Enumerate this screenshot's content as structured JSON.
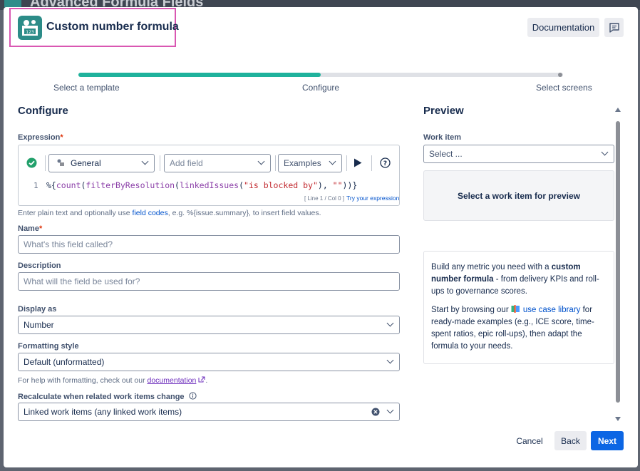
{
  "background": {
    "title": "Advanced Formula Fields"
  },
  "header": {
    "title": "Custom number formula",
    "documentation_label": "Documentation",
    "logo_badge": "123"
  },
  "stepper": {
    "steps": [
      {
        "label": "Select a template"
      },
      {
        "label": "Configure"
      },
      {
        "label": "Select screens"
      }
    ],
    "progress": 0.5
  },
  "configure": {
    "heading": "Configure",
    "expression": {
      "label": "Expression",
      "required_mark": "*",
      "context_select": "General",
      "add_field_placeholder": "Add field",
      "examples_label": "Examples",
      "line_number": "1",
      "code_prefix": "%{",
      "code_fn1": "count",
      "code_fn2": "filterByResolution",
      "code_fn3": "linkedIssues",
      "code_str1": "\"is blocked by\"",
      "code_sep": ", ",
      "code_str2": "\"\"",
      "code_suffix": "))}",
      "cursor_position": "[ Line 1 / Col 0 ]",
      "try_link": "Try your expression",
      "hint_prefix": "Enter plain text and optionally use ",
      "hint_link": "field codes",
      "hint_suffix": ", e.g. %{issue.summary}, to insert field values."
    },
    "name": {
      "label": "Name",
      "required_mark": "*",
      "placeholder": "What's this field called?"
    },
    "description": {
      "label": "Description",
      "placeholder": "What will the field be used for?"
    },
    "display_as": {
      "label": "Display as",
      "value": "Number"
    },
    "formatting": {
      "label": "Formatting style",
      "value": "Default (unformatted)",
      "help_prefix": "For help with formatting, check out our ",
      "help_link": "documentation",
      "help_suffix": "."
    },
    "recalculate": {
      "label": "Recalculate when related work items change",
      "value": "Linked work items (any linked work items)"
    }
  },
  "preview": {
    "heading": "Preview",
    "work_item_label": "Work item",
    "work_item_placeholder": "Select ...",
    "empty_message": "Select a work item for preview",
    "info_p1_a": "Build any metric you need with a ",
    "info_p1_b": "custom number formula",
    "info_p1_c": " - from delivery KPIs and roll-ups to governance scores.",
    "info_p2_a": "Start by browsing our ",
    "info_p2_link": "use case library",
    "info_p2_b": " for ready-made examples (e.g., ICE score, time-spent ratios, epic roll-ups), then adapt the formula to your needs."
  },
  "footer": {
    "cancel_label": "Cancel",
    "back_label": "Back",
    "next_label": "Next"
  },
  "colors": {
    "accent": "#1fb29c",
    "primary": "#0c66e4",
    "highlight": "#d957b2"
  }
}
